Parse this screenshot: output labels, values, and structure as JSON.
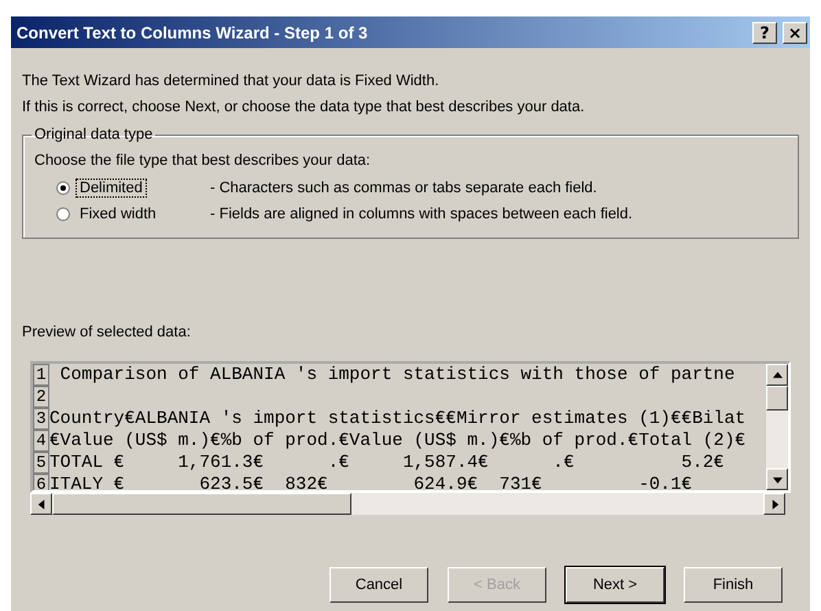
{
  "window": {
    "title": "Convert Text to Columns Wizard - Step 1 of 3",
    "controls": [
      {
        "kind": "help",
        "label": "?"
      },
      {
        "kind": "close",
        "label": "×"
      }
    ]
  },
  "intro": [
    "The Text Wizard has determined that your data is Fixed Width.",
    "If this is correct, choose Next, or choose the data type that best describes your data."
  ],
  "group": {
    "title": "Original data type",
    "prompt": "Choose the file type that best describes your data:",
    "options": [
      {
        "label": "Delimited",
        "description": "- Characters such as commas or tabs separate each field.",
        "selected": true
      },
      {
        "label": "Fixed width",
        "description": "- Fields are aligned in columns with spaces between each field.",
        "selected": false
      }
    ]
  },
  "preview": {
    "label": "Preview of selected data:",
    "rows": [
      {
        "number": "1",
        "text": " Comparison of ALBANIA 's import statistics with those of partne"
      },
      {
        "number": "2",
        "text": ""
      },
      {
        "number": "3",
        "text": "Country€ALBANIA 's import statistics€€Mirror estimates (1)€€Bilat"
      },
      {
        "number": "4",
        "text": "€Value (US$ m.)€%b of prod.€Value (US$ m.)€%b of prod.€Total (2)€"
      },
      {
        "number": "5",
        "text": "TOTAL €     1,761.3€      .€     1,587.4€      .€          5.2€"
      },
      {
        "number": "6",
        "text": "ITALY €       623.5€  832€        624.9€  731€         -0.1€"
      }
    ]
  },
  "buttons": [
    {
      "label": "Cancel",
      "disabled": false,
      "default": false
    },
    {
      "label": "< Back",
      "disabled": true,
      "default": false
    },
    {
      "label": "Next >",
      "disabled": false,
      "default": true
    },
    {
      "label": "Finish",
      "disabled": false,
      "default": false
    }
  ]
}
